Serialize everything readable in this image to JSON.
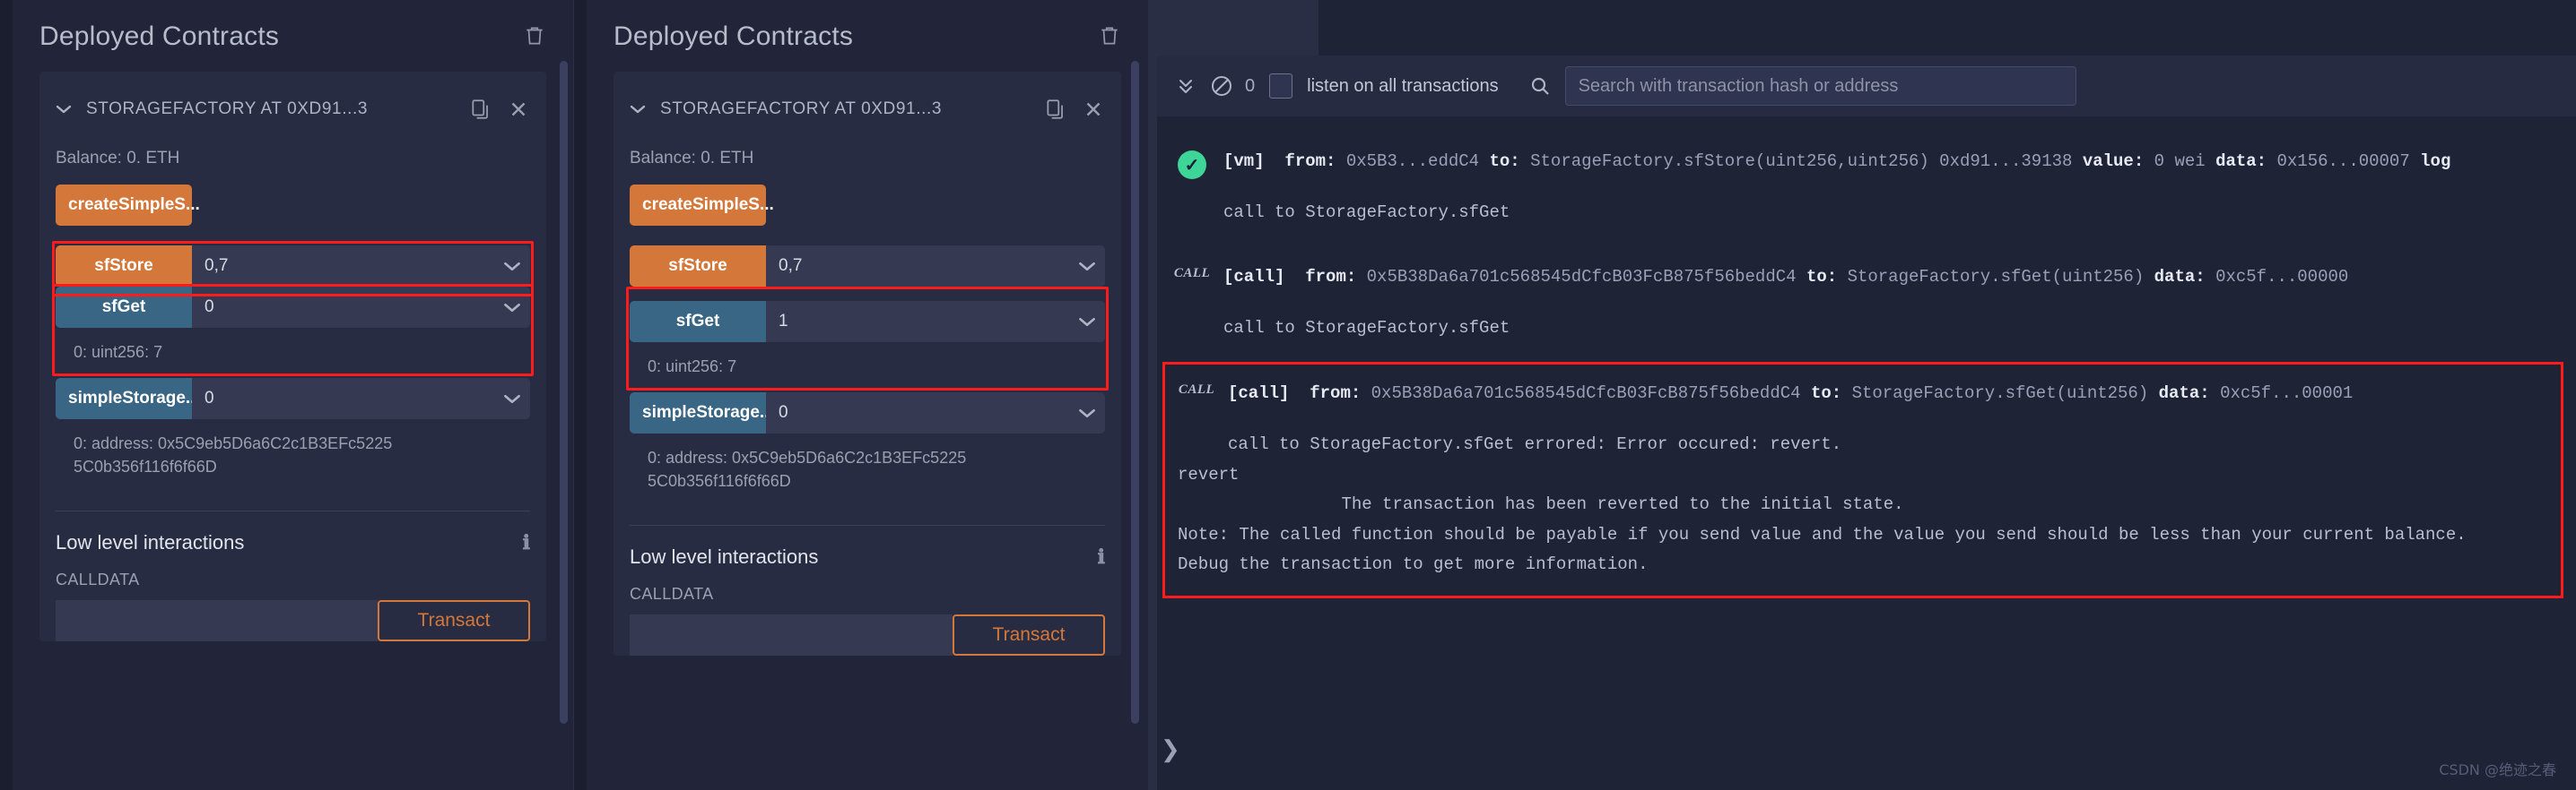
{
  "panels": [
    {
      "title": "Deployed Contracts",
      "trash_icon": "trash-icon",
      "contract": {
        "chevron_icon": "chevron-down-icon",
        "name": "STORAGEFACTORY AT 0XD91...3",
        "copy_icon": "copy-icon",
        "close_icon": "close-icon",
        "balance": "Balance: 0. ETH"
      },
      "functions": [
        {
          "label": "createSimpleS...",
          "kind": "orange",
          "has_input": false
        },
        {
          "label": "sfStore",
          "kind": "orange",
          "has_input": true,
          "value": "0,7",
          "result": "",
          "highlight": true
        },
        {
          "label": "sfGet",
          "kind": "blue",
          "has_input": true,
          "value": "0",
          "result": "0: uint256: 7",
          "highlight": true
        },
        {
          "label": "simpleStorage...",
          "kind": "blue",
          "has_input": true,
          "value": "0",
          "result": "0: address: 0x5C9eb5D6a6C2c1B3EFc5225\n5C0b356f116f6f66D",
          "highlight": false
        }
      ],
      "low_level": {
        "title": "Low level interactions",
        "info_icon": "info-icon",
        "calldata_label": "CALLDATA",
        "calldata_value": "",
        "transact_label": "Transact"
      }
    },
    {
      "title": "Deployed Contracts",
      "trash_icon": "trash-icon",
      "contract": {
        "chevron_icon": "chevron-down-icon",
        "name": "STORAGEFACTORY AT 0XD91...3",
        "copy_icon": "copy-icon",
        "close_icon": "close-icon",
        "balance": "Balance: 0. ETH"
      },
      "functions": [
        {
          "label": "createSimpleS...",
          "kind": "orange",
          "has_input": false
        },
        {
          "label": "sfStore",
          "kind": "orange",
          "has_input": true,
          "value": "0,7",
          "result": "",
          "highlight": false
        },
        {
          "label": "sfGet",
          "kind": "blue",
          "has_input": true,
          "value": "1",
          "result": "0: uint256: 7",
          "highlight": true
        },
        {
          "label": "simpleStorage...",
          "kind": "blue",
          "has_input": true,
          "value": "0",
          "result": "0: address: 0x5C9eb5D6a6C2c1B3EFc5225\n5C0b356f116f6f66D",
          "highlight": false
        }
      ],
      "low_level": {
        "title": "Low level interactions",
        "info_icon": "info-icon",
        "calldata_label": "CALLDATA",
        "calldata_value": "",
        "transact_label": "Transact"
      }
    }
  ],
  "terminal": {
    "toolbar": {
      "collapse_icon": "double-chevron-down-icon",
      "clear_icon": "no-entry-icon",
      "count": "0",
      "checkbox_checked": false,
      "listen_label": "listen on all transactions",
      "search_icon": "search-icon",
      "search_value": "",
      "search_placeholder": "Search with transaction hash or address"
    },
    "logs": [
      {
        "status": "success",
        "badge": "vm-check",
        "main_plain": "[vm]  from: 0x5B3...eddC4 to: StorageFactory.sfStore(uint256,uint256) 0xd91...39138 value: 0 wei data: 0x156...00007 log",
        "tag": "[vm]",
        "from_label": "from:",
        "from_value": "0x5B3...eddC4",
        "to_label": "to:",
        "to_value": "StorageFactory.sfStore(uint256,uint256) 0xd91...39138",
        "value_label": "value:",
        "value_value": "0 wei",
        "data_label": "data:",
        "data_value": "0x156...00007",
        "trailing": "log",
        "sub": "call to StorageFactory.sfGet",
        "highlight": false
      },
      {
        "status": "call",
        "badge": "CALL",
        "tag": "[call]",
        "from_label": "from:",
        "from_value": "0x5B38Da6a701c568545dCfcB03FcB875f56beddC4",
        "to_label": "to:",
        "to_value": "StorageFactory.sfGet(uint256)",
        "data_label": "data:",
        "data_value": "0xc5f...00000",
        "sub": "call to StorageFactory.sfGet",
        "highlight": false
      },
      {
        "status": "call",
        "badge": "CALL",
        "tag": "[call]",
        "from_label": "from:",
        "from_value": "0x5B38Da6a701c568545dCfcB03FcB875f56beddC4",
        "to_label": "to:",
        "to_value": "StorageFactory.sfGet(uint256)",
        "data_label": "data:",
        "data_value": "0xc5f...00001",
        "sub": "call to StorageFactory.sfGet errored: Error occured: revert.",
        "error_text": "revert\n\t\tThe transaction has been reverted to the initial state.\nNote: The called function should be payable if you send value and the value you send should be less than your current balance.\nDebug the transaction to get more information.",
        "highlight": true
      }
    ],
    "collapse_arrow": "❯",
    "watermark": "CSDN @绝迹之春"
  },
  "colors": {
    "orange": "#d4773a",
    "blue": "#396684",
    "highlight_red": "#fe1b1b",
    "success_green": "#3ed598",
    "panel_bg": "#22253a",
    "terminal_bg": "#1f2336"
  }
}
